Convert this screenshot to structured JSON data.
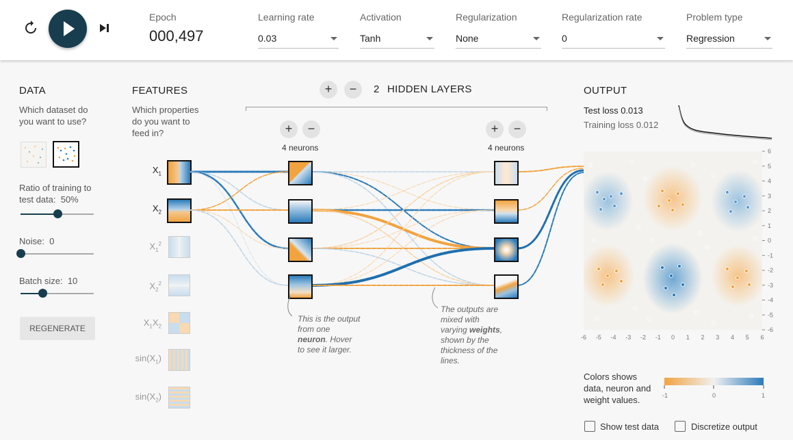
{
  "topbar": {
    "epoch_label": "Epoch",
    "epoch_value": "000,497",
    "learning_rate": {
      "label": "Learning rate",
      "value": "0.03"
    },
    "activation": {
      "label": "Activation",
      "value": "Tanh"
    },
    "regularization": {
      "label": "Regularization",
      "value": "None"
    },
    "regularization_rate": {
      "label": "Regularization rate",
      "value": "0"
    },
    "problem_type": {
      "label": "Problem type",
      "value": "Regression"
    },
    "icons": [
      "reset-icon",
      "play-icon",
      "step-icon"
    ]
  },
  "data_panel": {
    "title": "DATA",
    "question": "Which dataset do you want to use?",
    "ratio_label": "Ratio of training to test data:",
    "ratio_value": "50%",
    "ratio_fraction": 0.5,
    "noise_label": "Noise:",
    "noise_value": "0",
    "noise_fraction": 0,
    "batch_label": "Batch size:",
    "batch_value": "10",
    "batch_fraction": 0.3,
    "regenerate_label": "REGENERATE"
  },
  "features_panel": {
    "title": "FEATURES",
    "question": "Which properties do you want to feed in?",
    "features": [
      {
        "label": "X1",
        "sub": "1",
        "active": true
      },
      {
        "label": "X2",
        "sub": "2",
        "active": true
      },
      {
        "label": "X1²",
        "active": false
      },
      {
        "label": "X2²",
        "active": false
      },
      {
        "label": "X1X2",
        "active": false
      },
      {
        "label": "sin(X1)",
        "active": false
      },
      {
        "label": "sin(X2)",
        "active": false
      }
    ]
  },
  "network": {
    "hidden_count": "2",
    "hidden_label": "HIDDEN LAYERS",
    "layers": [
      {
        "neurons_label": "4 neurons"
      },
      {
        "neurons_label": "4 neurons"
      }
    ],
    "note_neuron": [
      "This is the output",
      "from one",
      "neuron",
      ". Hover",
      "to see it larger."
    ],
    "note_weights": [
      "The outputs are",
      "mixed with",
      "varying ",
      "weights",
      ",",
      "shown by the",
      "thickness of the",
      "lines."
    ]
  },
  "output_panel": {
    "title": "OUTPUT",
    "test_loss_label": "Test loss",
    "test_loss": "0.013",
    "training_loss_label": "Training loss",
    "training_loss": "0.012",
    "y_ticks": [
      "6",
      "5",
      "4",
      "3",
      "2",
      "1",
      "0",
      "-1",
      "-2",
      "-3",
      "-4",
      "-5",
      "-6"
    ],
    "x_ticks": [
      "-6",
      "-5",
      "-4",
      "-3",
      "-2",
      "-1",
      "0",
      "1",
      "2",
      "3",
      "4",
      "5",
      "6"
    ],
    "legend_text": [
      "Colors shows",
      "data, neuron and",
      "weight values."
    ],
    "legend_ticks": [
      "-1",
      "0",
      "1"
    ],
    "show_test_label": "Show test data",
    "discretize_label": "Discretize output"
  },
  "colors": {
    "orange": "#e8973a",
    "blue": "#1f77b4",
    "dark": "#183d4e"
  }
}
